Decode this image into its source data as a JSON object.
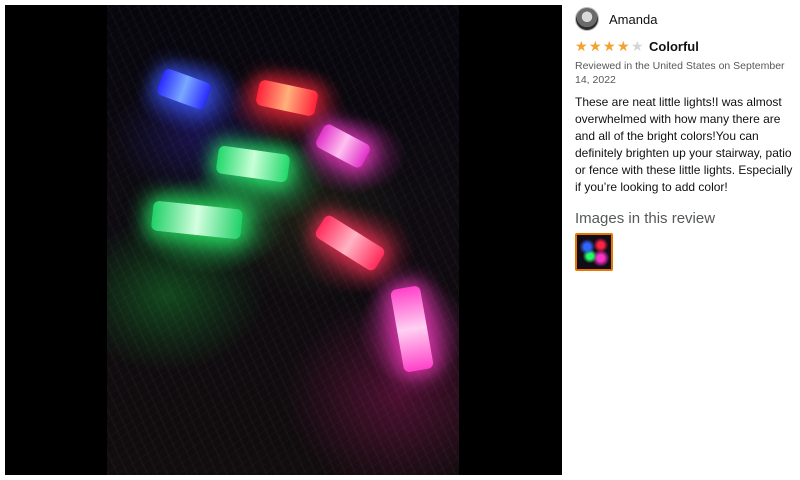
{
  "review": {
    "author": "Amanda",
    "rating": 4,
    "rating_max": 5,
    "title": "Colorful",
    "meta": "Reviewed in the United States on September 14, 2022",
    "body": "These are neat little lights!I was almost overwhelmed with how many there are and all of the bright colors!You can definitely brighten up your stairway, patio or fence with these little lights. Especially if you’re looking to add color!",
    "images_heading": "Images in this review"
  },
  "colors": {
    "star_filled": "#f6a12b",
    "thumb_border": "#e77600",
    "lights": [
      "#2f5bff",
      "#ff2a3a",
      "#ff3fd0",
      "#22ff77",
      "#27ff6e",
      "#ff3355",
      "#ff3fc8"
    ]
  },
  "icons": {
    "avatar": "avatar-icon",
    "star": "star-icon"
  }
}
